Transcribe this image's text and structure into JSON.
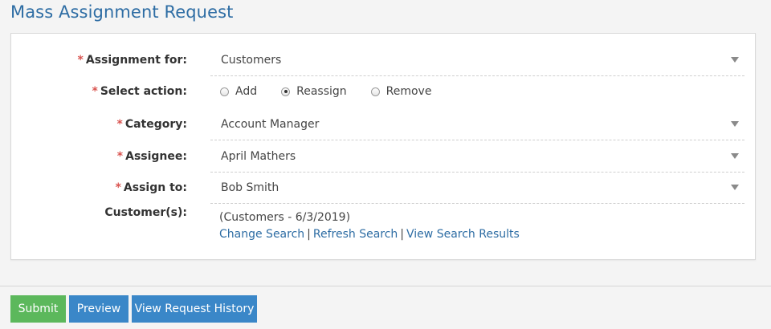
{
  "page": {
    "title": "Mass Assignment Request"
  },
  "form": {
    "assignment_for": {
      "label": "Assignment for:",
      "value": "Customers"
    },
    "select_action": {
      "label": "Select action:",
      "options": [
        {
          "label": "Add",
          "checked": false
        },
        {
          "label": "Reassign",
          "checked": true
        },
        {
          "label": "Remove",
          "checked": false
        }
      ]
    },
    "category": {
      "label": "Category:",
      "value": "Account Manager"
    },
    "assignee": {
      "label": "Assignee:",
      "value": "April Mathers"
    },
    "assign_to": {
      "label": "Assign to:",
      "value": "Bob Smith"
    },
    "customers": {
      "label": "Customer(s):",
      "value": "(Customers - 6/3/2019)",
      "links": {
        "change_search": "Change Search",
        "refresh_search": "Refresh Search",
        "view_results": "View Search Results",
        "separator": "|"
      }
    },
    "required_marker": "*"
  },
  "actions": {
    "submit": "Submit",
    "preview": "Preview",
    "history": "View Request History"
  },
  "colors": {
    "title": "#2e6da4",
    "required": "#d9534f",
    "submit_button": "#5cb85c",
    "primary_button": "#3a87c8",
    "link": "#2e6da4"
  },
  "icons": {
    "dropdown": "chevron-down-icon"
  }
}
